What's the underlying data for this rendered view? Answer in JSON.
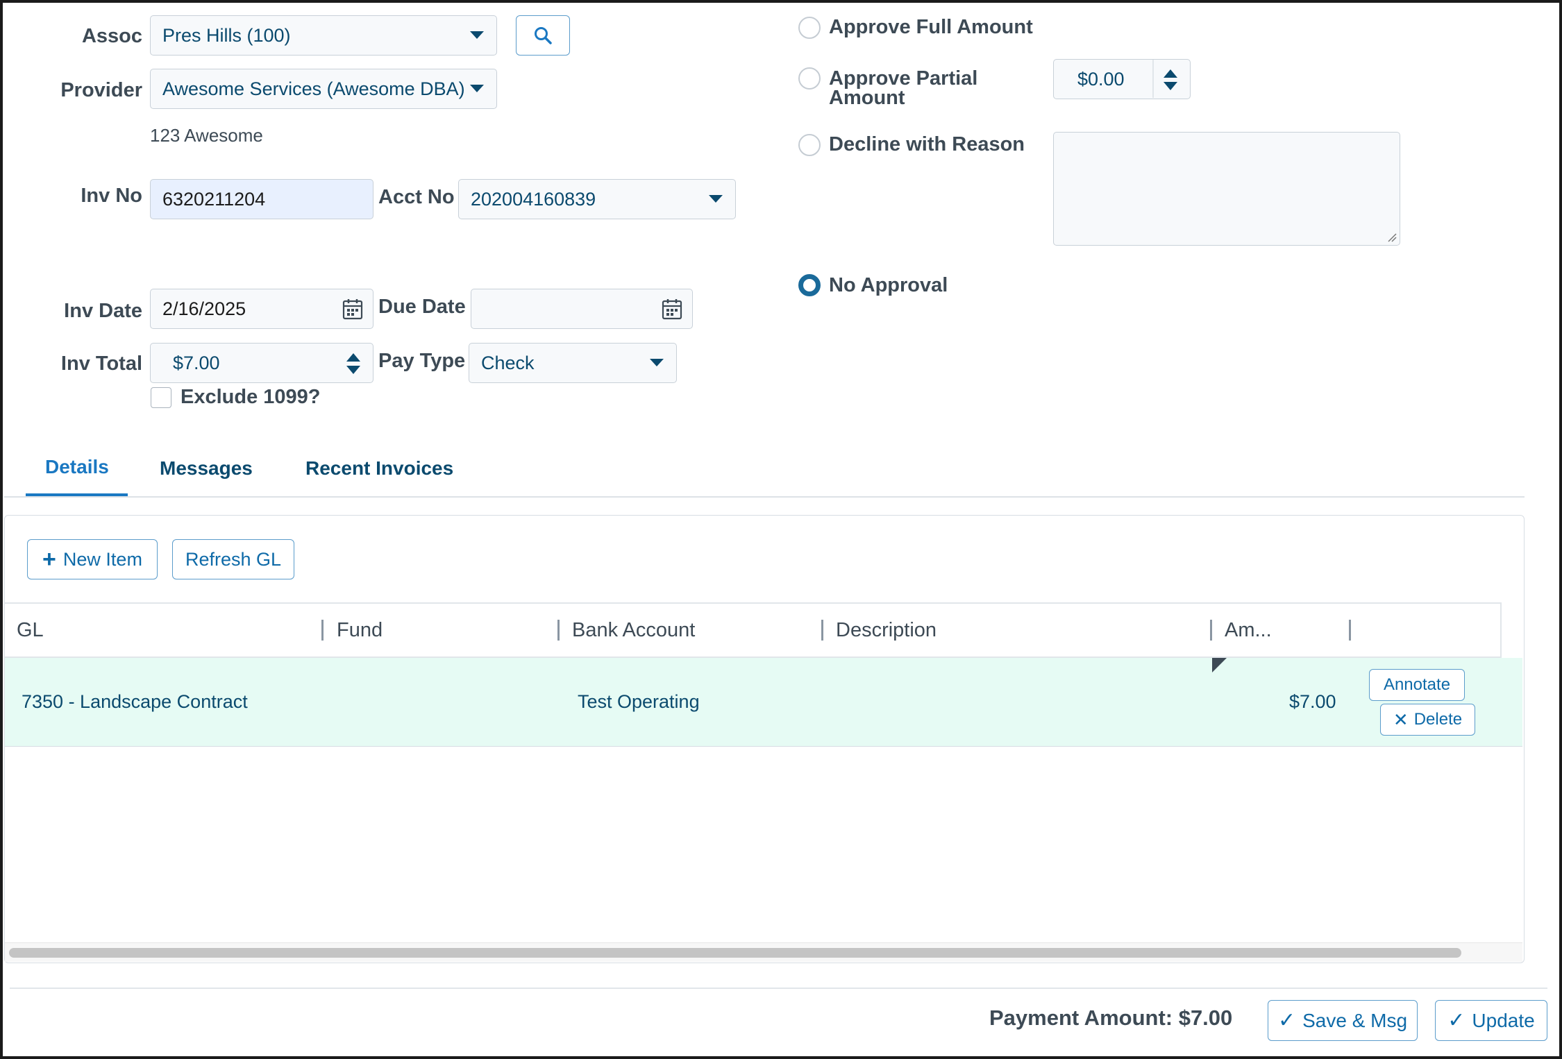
{
  "form": {
    "assoc_label": "Assoc",
    "assoc_value": "Pres Hills (100)",
    "provider_label": "Provider",
    "provider_value": "Awesome Services (Awesome DBA)",
    "provider_address": "123 Awesome",
    "inv_no_label": "Inv No",
    "inv_no_value": "6320211204",
    "acct_no_label": "Acct No",
    "acct_no_value": "202004160839",
    "inv_date_label": "Inv Date",
    "inv_date_value": "2/16/2025",
    "due_date_label": "Due Date",
    "due_date_value": "",
    "inv_total_label": "Inv Total",
    "inv_total_value": "$7.00",
    "pay_type_label": "Pay Type",
    "pay_type_value": "Check",
    "exclude_1099_label": "Exclude 1099?"
  },
  "approval": {
    "full_label": "Approve Full Amount",
    "partial_label_line1": "Approve Partial",
    "partial_label_line2": "Amount",
    "partial_amount": "$0.00",
    "decline_label": "Decline with Reason",
    "decline_reason": "",
    "none_label": "No Approval",
    "selected": "No Approval"
  },
  "tabs": [
    {
      "label": "Details",
      "active": true
    },
    {
      "label": "Messages",
      "active": false
    },
    {
      "label": "Recent Invoices",
      "active": false
    }
  ],
  "toolbar": {
    "new_item_label": "New Item",
    "refresh_gl_label": "Refresh GL"
  },
  "grid": {
    "columns": [
      "GL",
      "Fund",
      "Bank Account",
      "Description",
      "Am..."
    ],
    "rows": [
      {
        "gl": "7350 - Landscape Contract",
        "fund": "",
        "bank_account": "Test Operating",
        "description": "",
        "amount": "$7.00",
        "annotate_label": "Annotate",
        "delete_label": "Delete"
      }
    ]
  },
  "footer": {
    "payment_amount_label": "Payment Amount: $7.00",
    "save_msg_label": "Save & Msg",
    "update_label": "Update"
  },
  "colors": {
    "accent": "#1a78c2",
    "text_dark": "#3d4a55",
    "link_blue": "#0b4a6e",
    "row_highlight": "#e6fbf4"
  }
}
